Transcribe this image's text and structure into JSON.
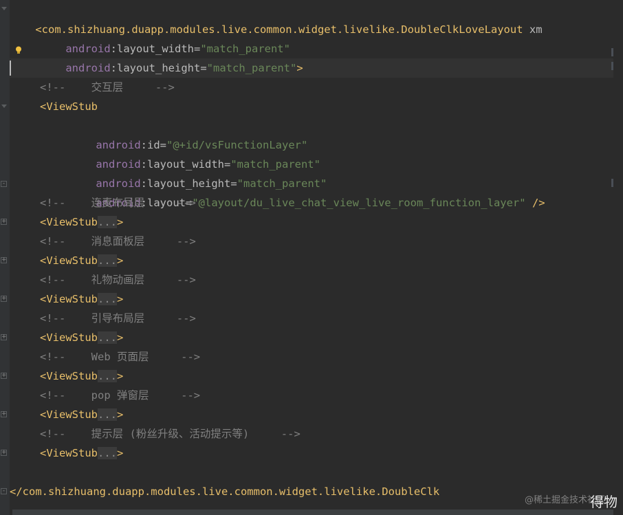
{
  "editor": {
    "line1": {
      "open": "<",
      "tag": "com.shizhuang.duapp.modules.live.common.widget.livelike.DoubleClkLoveLayout",
      "rest": " xm"
    },
    "line2": {
      "ns": "android",
      "colon": ":",
      "attr": "layout_width",
      "eq": "=",
      "val": "\"match_parent\""
    },
    "line3": {
      "ns": "android",
      "colon": ":",
      "attr": "layout_height",
      "eq": "=",
      "val": "\"match_parent\"",
      "close": ">"
    },
    "comment_jiaohu": "<!--    交互层     -->",
    "viewstub_open": "<ViewStub",
    "vs_id": {
      "ns": "android",
      "colon": ":",
      "attr": "id",
      "eq": "=",
      "val": "\"@+id/vsFunctionLayer\""
    },
    "vs_width": {
      "ns": "android",
      "colon": ":",
      "attr": "layout_width",
      "eq": "=",
      "val": "\"match_parent\""
    },
    "vs_height": {
      "ns": "android",
      "colon": ":",
      "attr": "layout_height",
      "eq": "=",
      "val": "\"match_parent\""
    },
    "vs_layout": {
      "ns": "android",
      "colon": ":",
      "attr": "layout",
      "eq": "=",
      "val": "\"@layout/du_live_chat_view_live_room_function_layer\"",
      "close": " />"
    },
    "folded_blocks": [
      {
        "comment": "<!--    连麦布局层     -->",
        "tag": "<ViewStub",
        "fold": "...",
        "close": ">"
      },
      {
        "comment": "<!--    消息面板层     -->",
        "tag": "<ViewStub",
        "fold": "...",
        "close": ">"
      },
      {
        "comment": "<!--    礼物动画层     -->",
        "tag": "<ViewStub",
        "fold": "...",
        "close": ">"
      },
      {
        "comment": "<!--    引导布局层     -->",
        "tag": "<ViewStub",
        "fold": "...",
        "close": ">"
      },
      {
        "comment": "<!--    Web 页面层     -->",
        "tag": "<ViewStub",
        "fold": "...",
        "close": ">"
      },
      {
        "comment": "<!--    pop 弹窗层     -->",
        "tag": "<ViewStub",
        "fold": "...",
        "close": ">"
      },
      {
        "comment": "<!--    提示层 (粉丝升级、活动提示等)     -->",
        "tag": "<ViewStub",
        "fold": "...",
        "close": ">"
      }
    ],
    "closing_line": "</com.shizhuang.duapp.modules.live.common.widget.livelike.DoubleClk"
  },
  "watermark": {
    "big": "得物",
    "small": "@稀土掘金技术社区"
  },
  "colors": {
    "background": "#2b2b2b",
    "tag": "#e8bf6a",
    "namespace": "#9876aa",
    "attribute": "#bababa",
    "value": "#6a8759",
    "comment": "#808080"
  }
}
